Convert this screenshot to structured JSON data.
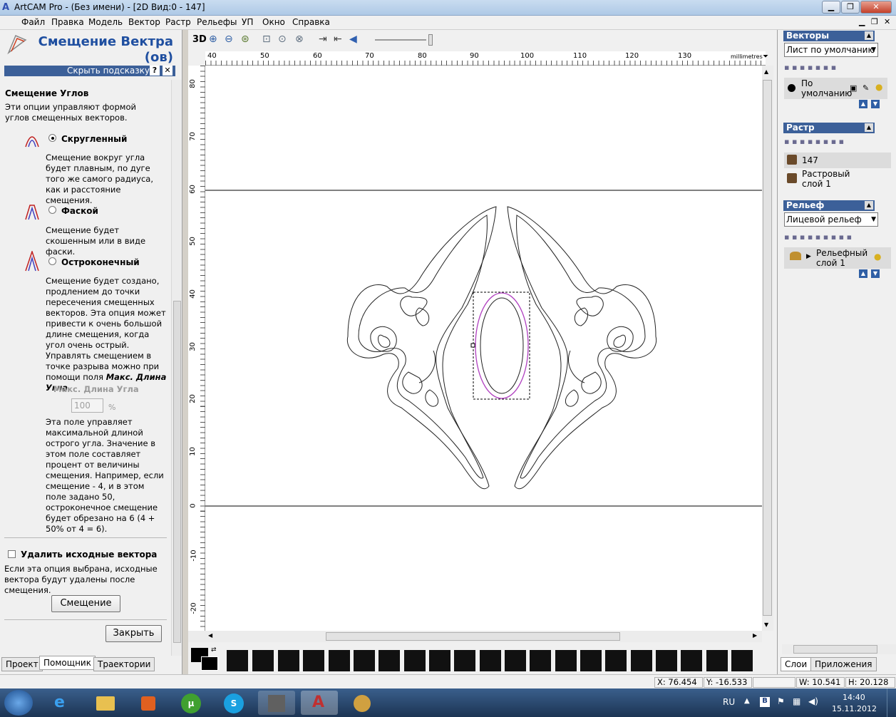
{
  "window": {
    "title": "ArtCAM Pro - (Без имени) - [2D Вид:0 - 147]",
    "min": "▁",
    "max": "❐",
    "close": "✕"
  },
  "menu": [
    "Файл",
    "Правка",
    "Модель",
    "Вектор",
    "Растр",
    "Рельефы",
    "УП",
    "Окно",
    "Справка"
  ],
  "left": {
    "title_line1": "Смещение Вектра",
    "title_line2": "(ов)",
    "hide_hint": "Скрыть подсказку",
    "help_q": "?",
    "help_x": "✕",
    "section_title": "Смещение Углов",
    "section_desc": "Эти опции управляют формой углов смещенных векторов.",
    "opt1_label": "Скругленный",
    "opt1_desc": "Смещение вокруг угла будет плавным, по дуге того же самого радиуса, как и расстояние смещения.",
    "opt2_label": "Фаской",
    "opt2_desc": "Смещение будет скошенным или в виде фаски.",
    "opt3_label": "Остроконечный",
    "opt3_desc": "Смещение будет создано, продлением до точки пересечения смещенных векторов. Эта опция может привести к очень большой длине смещения, когда угол очень острый. Управлять смещением в точке разрыва можно при помощи поля",
    "opt3_desc_bold": "Макс. Длина Угла",
    "opt3_desc_end": ".",
    "maxlen_label": "Макс. Длина Угла",
    "maxlen_value": "100",
    "maxlen_unit": "%",
    "maxlen_desc": "Эта поле управляет максимальной длиной острого угла. Значение в этом поле составляет процент от величины смещения. Например, если смещение - 4, и в этом поле задано 50, остроконечное смещение будет обрезано на 6 (4 + 50% от 4 = 6).",
    "delete_label": "Удалить исходные вектора",
    "delete_desc": "Если эта опция выбрана, исходные вектора будут удалены после смещения.",
    "offset_btn": "Смещение",
    "close_btn": "Закрыть",
    "tabs": [
      "Проект",
      "Помощник",
      "Траектории"
    ]
  },
  "toolbar": {
    "label_3d": "3D"
  },
  "ruler": {
    "h_ticks": [
      "40",
      "50",
      "60",
      "70",
      "80",
      "90",
      "100",
      "110",
      "120",
      "130"
    ],
    "units": "millimetres",
    "v_ticks": [
      "80",
      "70",
      "60",
      "50",
      "40",
      "30",
      "20",
      "10",
      "0",
      "-10",
      "-20"
    ]
  },
  "right": {
    "vectors_head": "Векторы",
    "vectors_combo": "Лист по умолчанию",
    "vectors_layer": "По умолчанию",
    "raster_head": "Растр",
    "raster_item1": "147",
    "raster_item2": "Растровый слой 1",
    "relief_head": "Рельеф",
    "relief_combo": "Лицевой рельеф",
    "relief_layer": "Рельефный слой 1",
    "tabs": [
      "Слои",
      "Приложения"
    ]
  },
  "status": {
    "x": "X: 76.454",
    "y": "Y: -16.533",
    "w": "W: 10.541",
    "h": "H: 20.128"
  },
  "taskbar": {
    "lang": "RU",
    "time": "14:40",
    "date": "15.11.2012"
  }
}
